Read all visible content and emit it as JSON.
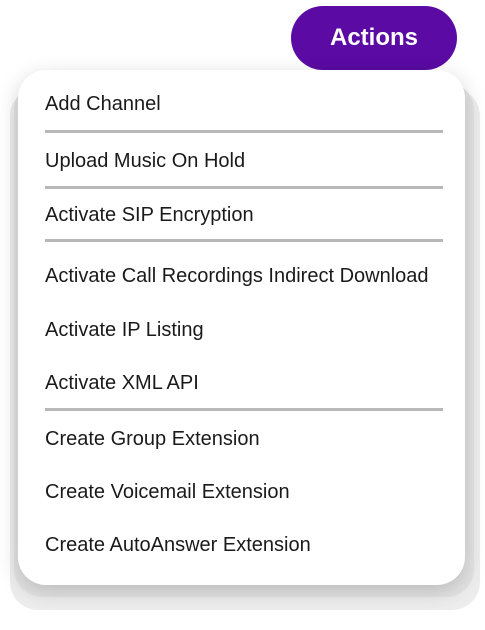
{
  "header": {
    "actions_label": "Actions"
  },
  "menu": {
    "items": [
      {
        "label": "Add Channel"
      },
      {
        "label": "Upload Music On Hold"
      },
      {
        "label": "Activate SIP Encryption"
      },
      {
        "label": "Activate Call Recordings Indirect Download"
      },
      {
        "label": "Activate IP Listing"
      },
      {
        "label": "Activate XML API"
      },
      {
        "label": "Create Group Extension"
      },
      {
        "label": "Create Voicemail Extension"
      },
      {
        "label": "Create AutoAnswer Extension"
      }
    ]
  },
  "colors": {
    "accent": "#5b0aa3",
    "divider": "#b8b8b8"
  }
}
